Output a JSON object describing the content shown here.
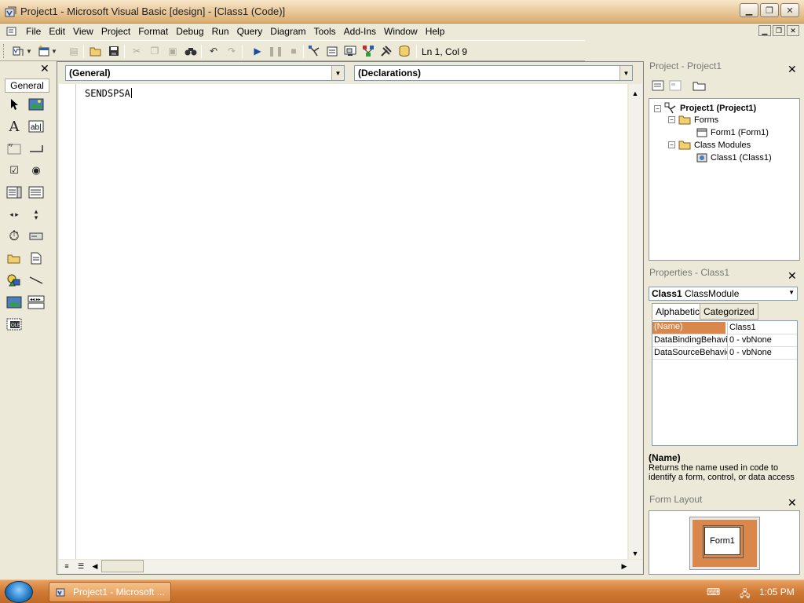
{
  "window": {
    "title": "Project1 - Microsoft Visual Basic [design] - [Class1 (Code)]",
    "controls": [
      "minimize",
      "maximize",
      "close"
    ]
  },
  "menu": {
    "items": [
      "File",
      "Edit",
      "View",
      "Project",
      "Format",
      "Debug",
      "Run",
      "Query",
      "Diagram",
      "Tools",
      "Add-Ins",
      "Window",
      "Help"
    ]
  },
  "toolbar": {
    "status": "Ln 1, Col 9",
    "icons": [
      "add-project-icon",
      "add-form-icon",
      "menu-editor-icon",
      "open-project-icon",
      "save-project-icon",
      "cut-icon",
      "copy-icon",
      "paste-icon",
      "find-icon",
      "undo-icon",
      "redo-icon",
      "start-icon",
      "break-icon",
      "end-icon",
      "project-explorer-icon",
      "properties-window-icon",
      "form-layout-icon",
      "object-browser-icon",
      "toolbox-icon",
      "data-view-icon"
    ]
  },
  "toolbox": {
    "tab_label": "General",
    "tools": [
      "pointer",
      "picturebox",
      "label",
      "textbox",
      "frame",
      "commandbutton",
      "checkbox",
      "optionbutton",
      "combobox",
      "listbox",
      "hscrollbar",
      "vscrollbar",
      "timer",
      "drivelistbox",
      "dirlistbox",
      "filelistbox",
      "shape",
      "line",
      "image",
      "data",
      "ole"
    ]
  },
  "code_window": {
    "object_combo": "(General)",
    "procedure_combo": "(Declarations)",
    "code_text": "SENDSPSA"
  },
  "project_panel": {
    "title": "Project - Project1",
    "tree": {
      "root": "Project1 (Project1)",
      "forms_folder": "Forms",
      "form_item": "Form1 (Form1)",
      "class_folder": "Class Modules",
      "class_item": "Class1 (Class1)"
    }
  },
  "properties_panel": {
    "title": "Properties - Class1",
    "object_name": "Class1",
    "object_type": "ClassModule",
    "tabs": [
      "Alphabetic",
      "Categorized"
    ],
    "rows": [
      {
        "name": "(Name)",
        "value": "Class1"
      },
      {
        "name": "DataBindingBehavior",
        "value": "0 - vbNone"
      },
      {
        "name": "DataSourceBehavior",
        "value": "0 - vbNone"
      }
    ],
    "desc_title": "(Name)",
    "desc_text": "Returns the name used in code to identify a form, control, or data access"
  },
  "form_layout_panel": {
    "title": "Form Layout",
    "form_label": "Form1"
  },
  "taskbar": {
    "task_label": "Project1 - Microsoft ...",
    "clock": "1:05 PM"
  },
  "colors": {
    "accent": "#d9874a",
    "selected_row": "#d9874a"
  }
}
